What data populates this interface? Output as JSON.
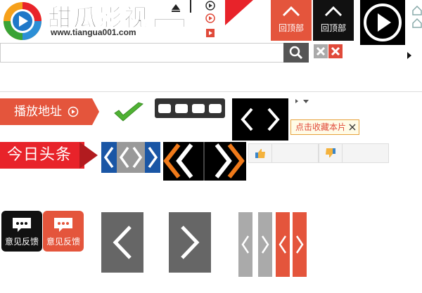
{
  "logo": {
    "name": "甜瓜影视",
    "url": "www.tiangua001.com"
  },
  "search": {
    "placeholder": ""
  },
  "back_to_top": {
    "red_label": "回顶部",
    "black_label": "回顶部"
  },
  "play_address": {
    "label": "播放地址"
  },
  "favorite": {
    "tooltip": "点击收藏本片"
  },
  "headline": {
    "label": "今日头条"
  },
  "feedback": {
    "black_label": "意见反馈",
    "red_label": "意见反馈"
  },
  "colors": {
    "accent_red": "#e4553c",
    "brand_red": "#e8232a",
    "dark": "#111111",
    "grey": "#666666",
    "blue": "#1a56a5",
    "orange": "#f07a1a"
  },
  "icons": [
    "logo-icon",
    "search-icon",
    "close-icon",
    "play-icon",
    "chevron-up-icon",
    "check-icon",
    "chevron-left-icon",
    "chevron-right-icon",
    "thumb-up-icon",
    "thumb-down-icon",
    "chat-bubble-icon",
    "home-icon"
  ]
}
